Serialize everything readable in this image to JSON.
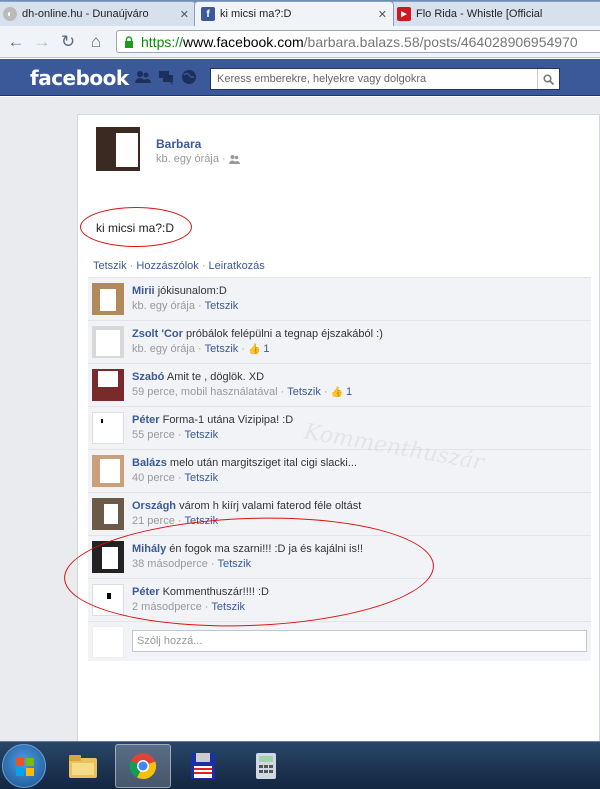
{
  "browser": {
    "tabs": [
      {
        "label": "dh-online.hu - Dunaújváro",
        "icon": "globe-icon"
      },
      {
        "label": "ki micsi ma?:D",
        "icon": "facebook-icon"
      },
      {
        "label": "Flo Rida - Whistle [Official",
        "icon": "youtube-icon"
      }
    ],
    "active_tab": 1,
    "url_scheme": "https://",
    "url_host": "www.facebook.com",
    "url_path": "/barbara.balazs.58/posts/464028906954970"
  },
  "fb": {
    "logo": "facebook",
    "search_placeholder": "Keress emberekre, helyekre vagy dolgokra",
    "brand_color": "#3b5998"
  },
  "post": {
    "author": "Barbara",
    "time": "kb. egy órája",
    "text": "ki micsi ma?:D",
    "actions": {
      "like": "Tetszik",
      "comment": "Hozzászólok",
      "unsubscribe": "Leiratkozás",
      "sep": " · "
    }
  },
  "comments": [
    {
      "name": "Mirii",
      "text": "jókisunalom:D",
      "meta": "kb. egy órája",
      "like": "Tetszik",
      "likes": ""
    },
    {
      "name": "Zsolt 'Cor",
      "text": "próbálok felépülni a tegnap éjszakából :)",
      "meta": "kb. egy órája",
      "like": "Tetszik",
      "likes": "1"
    },
    {
      "name": "Szabó",
      "text": "Amit te , döglök. XD",
      "meta": "59 perce, mobil használatával",
      "like": "Tetszik",
      "likes": "1"
    },
    {
      "name": "Péter",
      "text": "Forma-1 utána Vizipipa! :D",
      "meta": "55 perce",
      "like": "Tetszik",
      "likes": ""
    },
    {
      "name": "Balázs",
      "text": "melo után margitsziget ital cigi slacki...",
      "meta": "40 perce",
      "like": "Tetszik",
      "likes": ""
    },
    {
      "name": "Országh",
      "text": "várom h kiírj valami faterod féle oltást",
      "meta": "21 perce",
      "like": "Tetszik",
      "likes": ""
    },
    {
      "name": "Mihály",
      "text": "én fogok ma szarni!!! :D ja és kajálni is!!",
      "meta": "38 másodperce",
      "like": "Tetszik",
      "likes": ""
    },
    {
      "name": "Péter",
      "text": "Kommenthuszár!!!! :D",
      "meta": "2 másodperce",
      "like": "Tetszik",
      "likes": ""
    }
  ],
  "reply_placeholder": "Szólj hozzá...",
  "watermark": "Kommenthuszár",
  "taskbar": [
    "start-orb-icon",
    "explorer-icon",
    "chrome-icon",
    "floppy-icon",
    "calculator-icon"
  ]
}
